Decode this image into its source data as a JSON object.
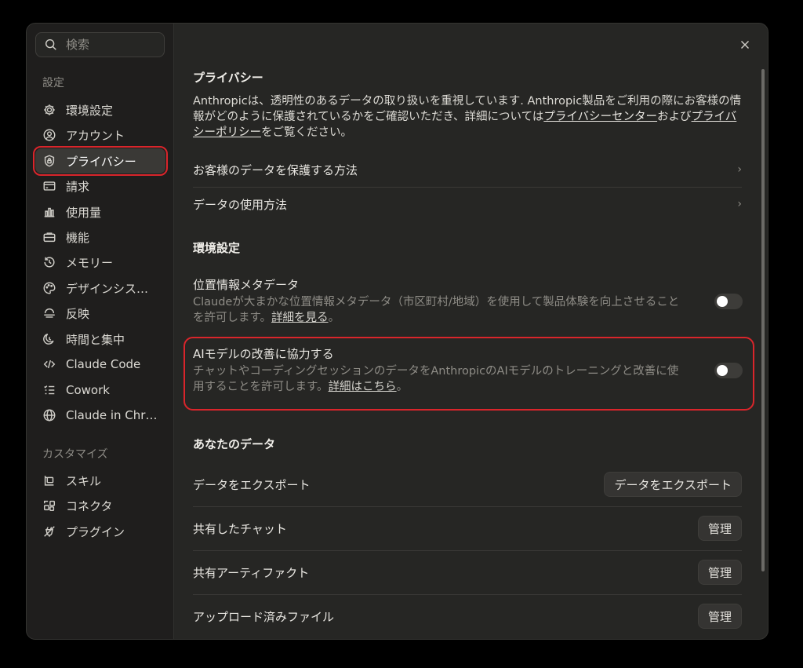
{
  "search": {
    "placeholder": "検索"
  },
  "sidebar": {
    "section_settings": "設定",
    "items": [
      {
        "label": "環境設定",
        "icon": "gear-icon"
      },
      {
        "label": "アカウント",
        "icon": "user-circle-icon"
      },
      {
        "label": "プライバシー",
        "icon": "shield-lock-icon",
        "active": true
      },
      {
        "label": "請求",
        "icon": "credit-card-icon"
      },
      {
        "label": "使用量",
        "icon": "bar-chart-icon"
      },
      {
        "label": "機能",
        "icon": "toolbox-icon"
      },
      {
        "label": "メモリー",
        "icon": "history-icon"
      },
      {
        "label": "デザインシス…",
        "icon": "palette-icon"
      },
      {
        "label": "反映",
        "icon": "reflection-icon"
      },
      {
        "label": "時間と集中",
        "icon": "moon-clock-icon"
      },
      {
        "label": "Claude Code",
        "icon": "code-icon"
      },
      {
        "label": "Cowork",
        "icon": "checklist-icon"
      },
      {
        "label": "Claude in Chr…",
        "icon": "globe-icon"
      }
    ],
    "section_customize": "カスタマイズ",
    "custom_items": [
      {
        "label": "スキル",
        "icon": "skill-icon"
      },
      {
        "label": "コネクタ",
        "icon": "connector-icon"
      },
      {
        "label": "プラグイン",
        "icon": "plug-icon"
      }
    ]
  },
  "privacy": {
    "title": "プライバシー",
    "intro_part1": "Anthropicは、透明性のあるデータの取り扱いを重視しています. Anthropic製品をご利用の際にお客様の情報がどのように保護されているかをご確認いただき、詳細については",
    "privacy_center_link": "プライバシーセンター",
    "intro_part2": "および",
    "privacy_policy_link": "プライバシーポリシー",
    "intro_part3": "をご覧ください。",
    "links": [
      {
        "label": "お客様のデータを保護する方法"
      },
      {
        "label": "データの使用方法"
      }
    ]
  },
  "preferences": {
    "title": "環境設定",
    "location": {
      "title": "位置情報メタデータ",
      "desc": "Claudeが大まかな位置情報メタデータ（市区町村/地域）を使用して製品体験を向上させることを許可します。",
      "link": "詳細を見る",
      "suffix": "。",
      "enabled": false
    },
    "model_training": {
      "title": "AIモデルの改善に協力する",
      "desc": "チャットやコーディングセッションのデータをAnthropicのAIモデルのトレーニングと改善に使用することを許可します。",
      "link": "詳細はこちら",
      "suffix": "。",
      "enabled": false
    }
  },
  "your_data": {
    "title": "あなたのデータ",
    "rows": [
      {
        "label": "データをエクスポート",
        "button": "データをエクスポート"
      },
      {
        "label": "共有したチャット",
        "button": "管理"
      },
      {
        "label": "共有アーティファクト",
        "button": "管理"
      },
      {
        "label": "アップロード済みファイル",
        "button": "管理"
      }
    ]
  },
  "colors": {
    "highlight": "#d9252b",
    "background": "#262624",
    "sidebar": "#1f1e1d"
  }
}
